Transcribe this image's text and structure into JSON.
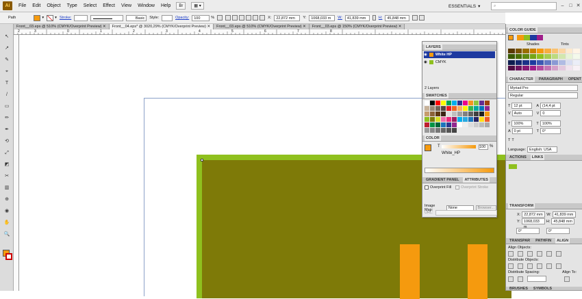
{
  "app": {
    "logo": "Ai",
    "menu": [
      "File",
      "Edit",
      "Object",
      "Type",
      "Select",
      "Effect",
      "View",
      "Window",
      "Help"
    ],
    "mini_btn_1": "Br",
    "mini_btn_2": "▦ ▾",
    "workspace": "ESSENTIALS",
    "workspace_arrow": "▾",
    "search_placeholder": ""
  },
  "window_controls": [
    "–",
    "□",
    "✕"
  ],
  "control_bar": {
    "selection_type": "Path",
    "fill_color": "#f59a0e",
    "stroke_label": "Stroke:",
    "stroke_style": "Basic",
    "style_label": "Style:",
    "opacity_label": "Opacity:",
    "opacity_value": "100",
    "opacity_unit": "%",
    "x_label": "X:",
    "x_value": "22,872 mm",
    "y_label": "Y:",
    "y_value": "1068,033 m",
    "w_label": "W:",
    "w_value": "41,839 mm",
    "h_label": "H:",
    "h_value": "45,848 mm"
  },
  "doc_tabs": [
    {
      "label": "Front__03.eps @ 510% (CMYK/Overprint Preview)",
      "active": false
    },
    {
      "label": "Front__04.eps* @ 3020,29% (CMYK/Overprint Preview)",
      "active": true
    },
    {
      "label": "Front__03.eps @ 510% (CMYK/Overprint Preview)",
      "active": false
    },
    {
      "label": "Front__03.eps @ 150% (CMYK/Overprint Preview)",
      "active": false
    }
  ],
  "ruler_ticks": [
    "2",
    "3",
    "0",
    "1",
    "2",
    "3",
    "4",
    "5",
    "6",
    "7",
    "8"
  ],
  "canvas": {
    "artboard_border": "#8aa0c8",
    "green": "#8fc01e",
    "olive": "#7e7a08",
    "orange": "#f59a0e"
  },
  "layers_panel": {
    "tab": "LAYERS",
    "layers": [
      {
        "name": "White HP",
        "selected": true
      },
      {
        "name": "CMYK",
        "selected": false
      }
    ],
    "count": "2 Layers"
  },
  "swatches_panel": {
    "tab": "SWATCHES"
  },
  "color_panel": {
    "tab": "COLOR",
    "t_label": "T",
    "t_value": "100",
    "t_unit": "%",
    "swatch_name": "White_HP"
  },
  "attributes_panel": {
    "tab_inactive": "GRADIENT PANEL",
    "tab": "ATTRIBUTES",
    "overprint_fill": "Overprint Fill",
    "overprint_stroke": "Overprint Stroke",
    "imagemap_label": "Image Map:",
    "imagemap_value": "None",
    "browser_btn": "Browser...",
    "url_label": "URL:"
  },
  "right_dock": {
    "color_guide_tab": "COLOR GUIDE",
    "shades": "Shades",
    "tints": "Tints",
    "character_tab": "CHARACTER",
    "paragraph_tab": "PARAGRAPH",
    "opentype_tab": "OPENT",
    "font": "Myriad Pro",
    "style": "Regular",
    "size": "12 pt",
    "leading": "(14,4 pt",
    "kerning": "Auto",
    "tracking": "0",
    "hscale": "100%",
    "vscale": "100%",
    "baseline": "0 pt",
    "rotation": "0°",
    "language_label": "Language:",
    "language": "English: USA",
    "actions_tab": "ACTIONS",
    "links_tab": "LINKS",
    "transform_tab": "TRANSFORM",
    "tx": "22,872 mm",
    "ty": "1068,033 m",
    "tw": "41,839 mm",
    "th": "45,848 mm",
    "angle1": "0°",
    "angle2": "0°",
    "transparency_tab": "TRANSPAR",
    "pathfinder_tab": "PATHFIN",
    "align_tab": "ALIGN",
    "align_objects": "Align Objects:",
    "distribute_objects": "Distribute Objects:",
    "distribute_spacing": "Distribute Spacing:",
    "align_to": "Align To:",
    "brushes_tab": "BRUSHES",
    "symbols_tab": "SYMBOLS"
  }
}
